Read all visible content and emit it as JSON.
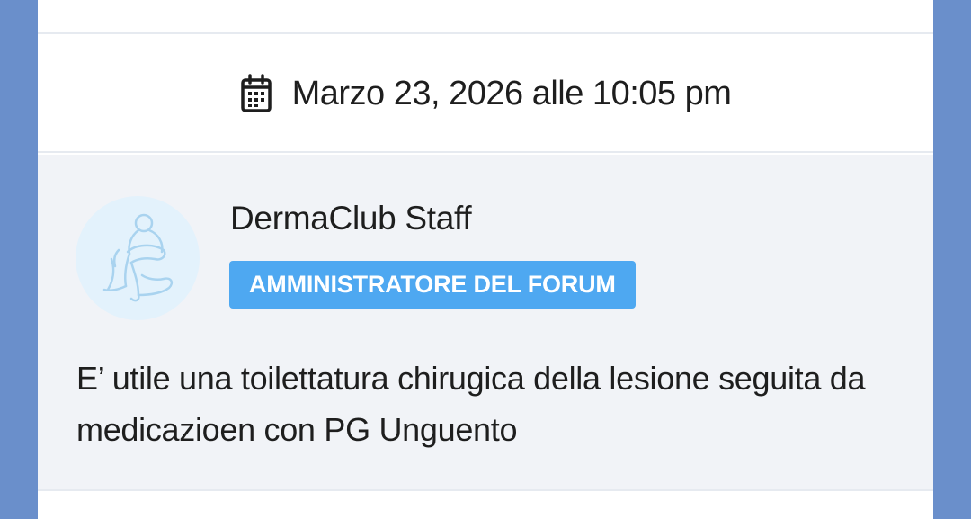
{
  "post": {
    "date": "Marzo 23, 2026 alle 10:05 pm",
    "calendar_icon": "calendar-icon",
    "author": {
      "name": "DermaClub Staff",
      "role": "AMMINISTRATORE DEL FORUM",
      "avatar_icon": "seated-figure-avatar"
    },
    "body": "E’ utile una toilettatura chirugica della lesione seguita da medicazioen con PG Unguento"
  },
  "colors": {
    "page_background": "#6a8fcb",
    "card_background": "#ffffff",
    "post_background": "#f1f3f7",
    "badge_background": "#4ea8f1",
    "avatar_background": "#e3f2fc",
    "text": "#1e1e1e"
  }
}
